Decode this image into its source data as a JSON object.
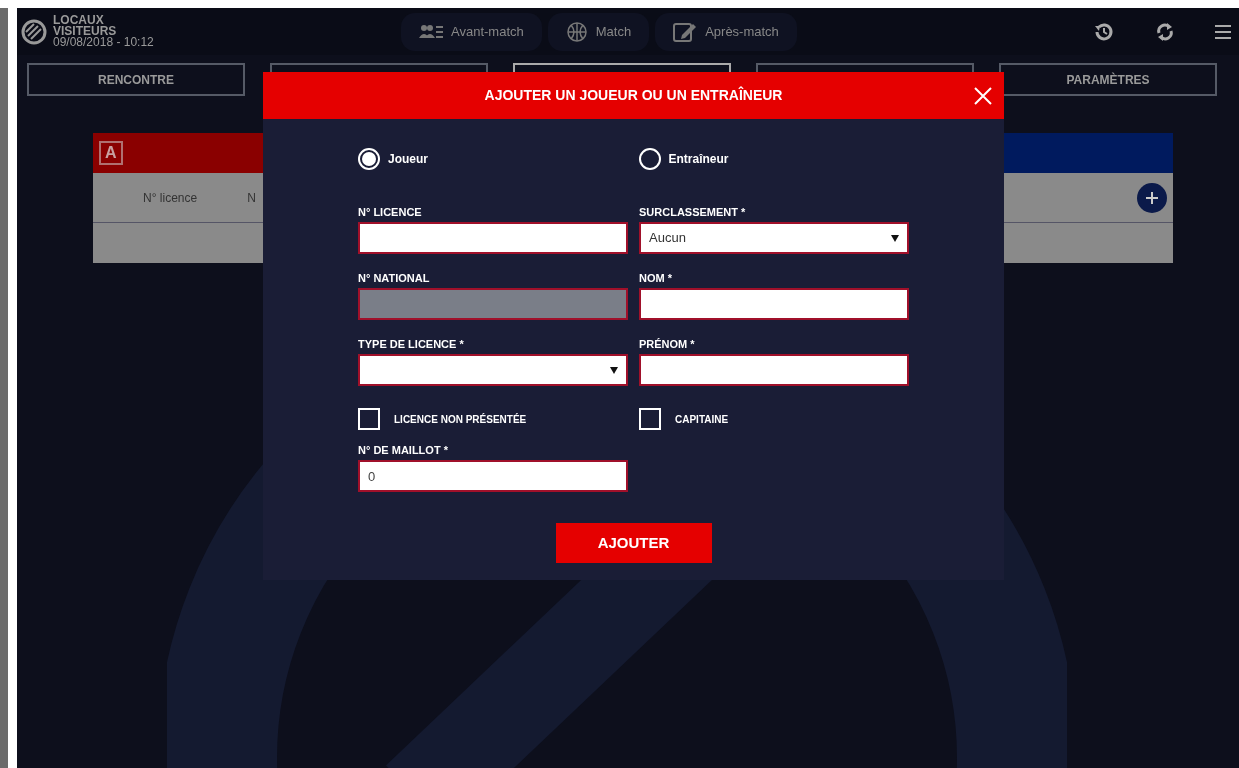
{
  "header": {
    "home": "LOCAUX",
    "away": "VISITEURS",
    "datetime": "09/08/2018 - 10:12"
  },
  "nav": [
    {
      "label": "Avant-match",
      "kind": "roster"
    },
    {
      "label": "Match",
      "kind": "ball"
    },
    {
      "label": "Après-match",
      "kind": "edit"
    }
  ],
  "tabs": [
    {
      "label": "RENCONTRE",
      "selected": false
    },
    {
      "selected": false
    },
    {
      "selected": true
    },
    {
      "selected": false
    },
    {
      "label": "PARAMÈTRES",
      "selected": false
    }
  ],
  "team_panel": {
    "letter": "A",
    "columns": [
      "N° licence",
      "N"
    ]
  },
  "modal": {
    "title": "AJOUTER UN JOUEUR OU UN ENTRAÎNEUR",
    "roles": [
      {
        "label": "Joueur",
        "selected": true
      },
      {
        "label": "Entraîneur",
        "selected": false
      }
    ],
    "fields": [
      {
        "kind": "text",
        "label": "N° LICENCE"
      },
      {
        "kind": "select",
        "label": "SURCLASSEMENT *",
        "value": "Aucun"
      },
      {
        "kind": "text",
        "label": "N° NATIONAL",
        "disabled": true
      },
      {
        "kind": "text",
        "label": "NOM *"
      },
      {
        "kind": "select",
        "label": "TYPE DE LICENCE *"
      },
      {
        "kind": "text",
        "label": "PRÉNOM *"
      },
      {
        "kind": "checkbox",
        "label": "LICENCE NON PRÉSENTÉE",
        "checked": false
      },
      {
        "kind": "checkbox",
        "label": "CAPITAINE",
        "checked": false
      },
      {
        "kind": "text",
        "label": "N° DE MAILLOT *",
        "value": "0"
      }
    ],
    "submit": "AJOUTER"
  }
}
